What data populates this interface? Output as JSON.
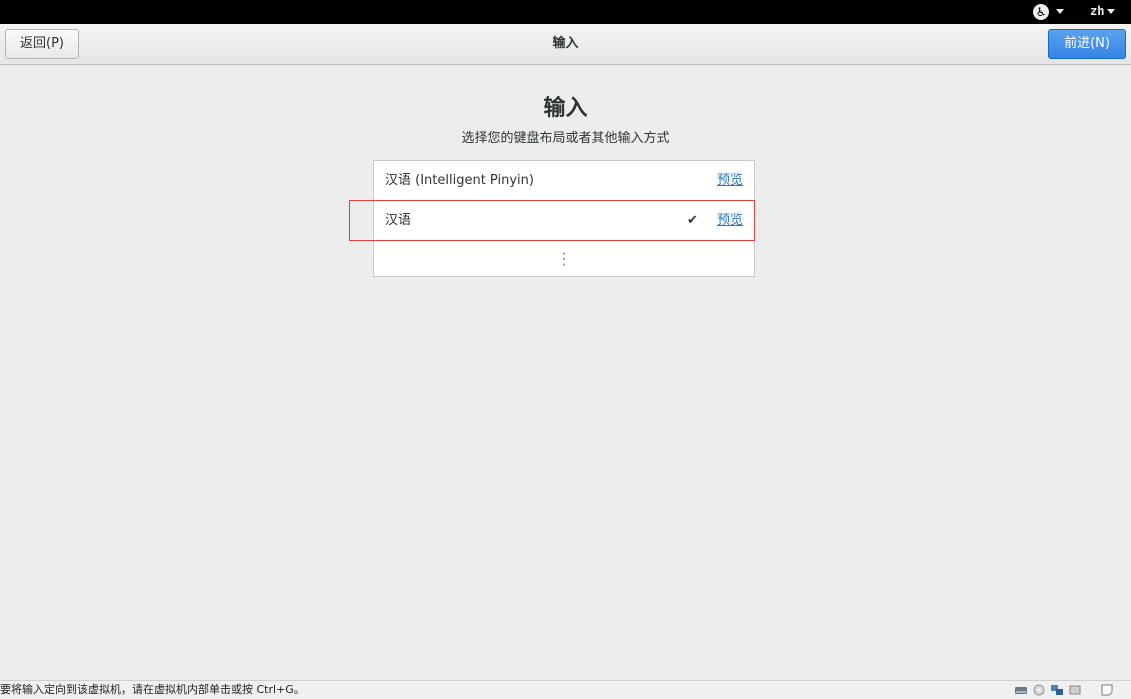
{
  "topbar": {
    "accessibility_icon": "accessibility-icon",
    "language_label": "zh"
  },
  "header": {
    "back_label": "返回(P)",
    "title": "输入",
    "next_label": "前进(N)"
  },
  "main": {
    "title": "输入",
    "subtitle": "选择您的键盘布局或者其他输入方式",
    "input_methods": [
      {
        "name": "汉语 (Intelligent Pinyin)",
        "preview_label": "预览",
        "selected": false
      },
      {
        "name": "汉语",
        "preview_label": "预览",
        "selected": true
      }
    ],
    "more_icon": "vertical-ellipsis-icon"
  },
  "statusbar": {
    "message": "要将输入定向到该虚拟机，请在虚拟机内部单击或按 Ctrl+G。"
  },
  "colors": {
    "accent": "#3584e4",
    "link": "#2a76c6",
    "highlight": "#e2403e"
  }
}
